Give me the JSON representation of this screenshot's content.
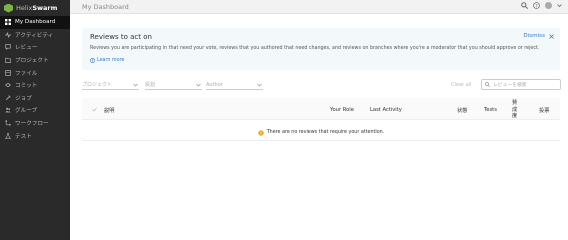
{
  "brand": {
    "prefix": "Helix",
    "name": "Swarm"
  },
  "sidebar": {
    "items": [
      {
        "label": "My Dashboard",
        "icon": "dashboard-icon",
        "active": true
      },
      {
        "label": "アクティビティ",
        "icon": "activity-icon"
      },
      {
        "label": "レビュー",
        "icon": "review-icon"
      },
      {
        "label": "プロジェクト",
        "icon": "project-icon"
      },
      {
        "label": "ファイル",
        "icon": "file-icon"
      },
      {
        "label": "コミット",
        "icon": "commit-icon"
      },
      {
        "label": "ジョブ",
        "icon": "job-icon"
      },
      {
        "label": "グループ",
        "icon": "group-icon"
      },
      {
        "label": "ワークフロー",
        "icon": "workflow-icon"
      },
      {
        "label": "テスト",
        "icon": "test-icon"
      }
    ]
  },
  "topbar": {
    "title": "My Dashboard",
    "help": "?"
  },
  "banner": {
    "title": "Reviews to act on",
    "dismiss": "Dismiss",
    "text": "Reviews you are participating in that need your vote, reviews that you authored that need changes, and reviews on branches where you're a moderator that you should approve or reject.",
    "learn_more": "Learn more"
  },
  "filters": {
    "project": "プロジェクト",
    "role": "役割",
    "author": "Author",
    "clear_all": "Clear all",
    "search_placeholder": "レビューを検索"
  },
  "table": {
    "headers": {
      "description": "説明",
      "your_role": "Your Role",
      "last_activity": "Last Activity",
      "status": "状態",
      "tests": "Tests",
      "approval_line1": "賛",
      "approval_line2": "成",
      "approval_line3": "度",
      "comments": "投票"
    },
    "empty_message": "There are no reviews that require your attention."
  },
  "colors": {
    "sidebar_bg": "#2a2a2a",
    "accent": "#3a79c6",
    "brand_green": "#7cb342",
    "warning": "#f0a30a"
  }
}
